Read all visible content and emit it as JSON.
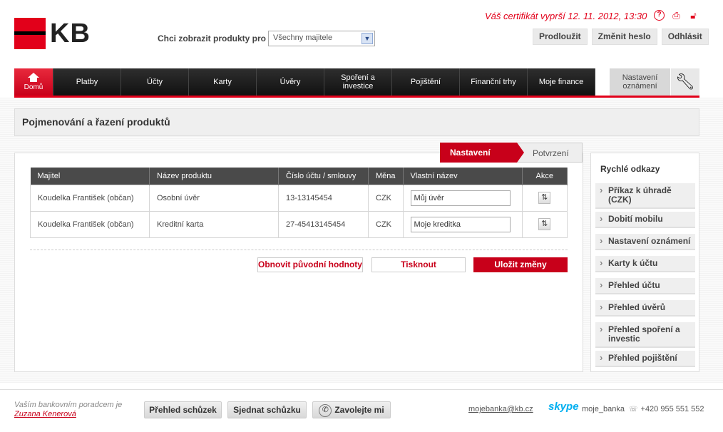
{
  "brand": {
    "logo_text": "KB",
    "accent": "#e2001a"
  },
  "owner_filter": {
    "label": "Chci zobrazit produkty pro",
    "selected": "Všechny majitele"
  },
  "certificate_notice": "Váš certifikát vyprší 12. 11. 2012, 13:30",
  "top_icons": [
    "help-icon",
    "print-icon",
    "lock-icon"
  ],
  "top_buttons": {
    "extend": "Prodloužit",
    "change_password": "Změnit heslo",
    "logout": "Odhlásit"
  },
  "nav": {
    "home": "Domů",
    "items": [
      "Platby",
      "Účty",
      "Karty",
      "Úvěry",
      "Spoření a investice",
      "Pojištění",
      "Finanční trhy",
      "Moje finance"
    ],
    "settings": "Nastavení oznámení"
  },
  "page_title": "Pojmenování a řazení produktů",
  "steps": {
    "active": "Nastavení",
    "next": "Potvrzení"
  },
  "table": {
    "headers": [
      "Majitel",
      "Název produktu",
      "Číslo účtu / smlouvy",
      "Měna",
      "Vlastní název",
      "Akce"
    ],
    "rows": [
      {
        "owner": "Koudelka František (občan)",
        "product": "Osobní úvěr",
        "number": "13-13145454",
        "currency": "CZK",
        "custom_name": "Můj úvěr"
      },
      {
        "owner": "Koudelka František (občan)",
        "product": "Kreditní karta",
        "number": "27-45413145454",
        "currency": "CZK",
        "custom_name": "Moje kreditka"
      }
    ]
  },
  "actions": {
    "restore": "Obnovit původní hodnoty",
    "print": "Tisknout",
    "save": "Uložit změny"
  },
  "quick_links": {
    "title": "Rychlé odkazy",
    "items": [
      "Příkaz k úhradě (CZK)",
      "Dobití mobilu",
      "Nastavení oznámení",
      "Karty k účtu",
      "Přehled účtu",
      "Přehled úvěrů",
      "Přehled spoření a investic",
      "Přehled pojištění"
    ]
  },
  "footer": {
    "advisor_text": "Vaším bankovním poradcem je",
    "advisor_name": "Zuzana Kenerová",
    "meetings": "Přehled schůzek",
    "schedule": "Sjednat schůzku",
    "call_me": "Zavolejte mi",
    "email": "mojebanka@kb.cz",
    "skype_logo": "skype",
    "skype_id": "moje_banka",
    "phone": "+420 955 551 552"
  }
}
